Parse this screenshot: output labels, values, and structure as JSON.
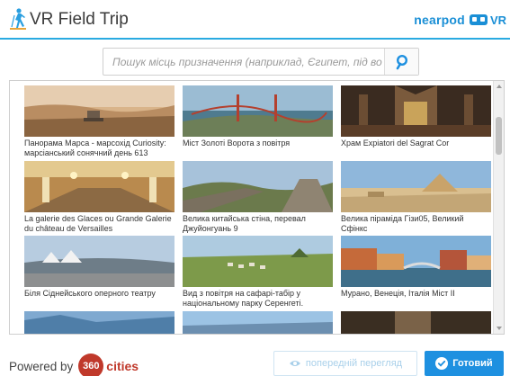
{
  "header": {
    "title": "VR Field Trip",
    "brand": "nearpod",
    "brand_suffix": "VR",
    "title_icon": "hiker-icon",
    "brand_icon": "vr-goggles-icon",
    "accent_color": "#29aae1"
  },
  "search": {
    "placeholder": "Пошук місць призначення (наприклад, Єгипет, під во",
    "value": "",
    "icon": "search-icon"
  },
  "gallery": {
    "items": [
      {
        "caption": "Панорама Марса - марсохід Curiosity: марсіанський сонячний день 613"
      },
      {
        "caption": "Міст Золоті Ворота з повітря"
      },
      {
        "caption": "Храм Expiatori del Sagrat Cor"
      },
      {
        "caption": "La galerie des Glaces ou Grande Galerie du château de Versailles"
      },
      {
        "caption": "Велика китайська стіна, перевал Джуйонгуань 9"
      },
      {
        "caption": "Велика піраміда Гізи05, Великий Сфінкс"
      },
      {
        "caption": "Біля Сіднейського оперного театру"
      },
      {
        "caption": "Вид з повітря на сафарі-табір у національному парку Серенгеті."
      },
      {
        "caption": "Мурано, Венеція, Італія Міст II"
      },
      {
        "caption": ""
      },
      {
        "caption": ""
      },
      {
        "caption": ""
      }
    ]
  },
  "footer": {
    "powered_by": "Powered by",
    "badge": "360",
    "brand": "cities",
    "preview_label": "попередній перегляд",
    "preview_icon": "eye-icon",
    "done_label": "Готовий",
    "done_icon": "check-circle-icon",
    "done_color": "#1e90e0",
    "brand_color": "#c0392b"
  }
}
